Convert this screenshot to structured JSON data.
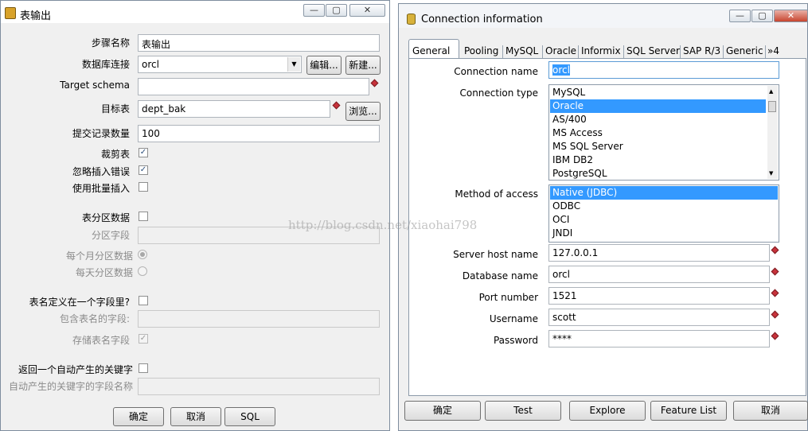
{
  "left_window": {
    "title": "表输出",
    "fields": {
      "step_name_label": "步骤名称",
      "step_name_value": "表输出",
      "db_conn_label": "数据库连接",
      "db_conn_value": "orcl",
      "edit_button": "编辑...",
      "new_button": "新建...",
      "target_schema_label": "Target schema",
      "target_schema_value": "",
      "target_table_label": "目标表",
      "target_table_value": "dept_bak",
      "browse_button": "浏览...",
      "commit_size_label": "提交记录数量",
      "commit_size_value": "100",
      "truncate_label": "裁剪表",
      "ignore_errors_label": "忽略插入错误",
      "batch_insert_label": "使用批量插入",
      "partition_label": "表分区数据",
      "partition_field_label": "分区字段",
      "partition_monthly_label": "每个月分区数据",
      "partition_daily_label": "每天分区数据",
      "table_name_in_field_label": "表名定义在一个字段里?",
      "field_with_table_name_label": "包含表名的字段:",
      "store_table_name_label": "存储表名字段",
      "return_key_label": "返回一个自动产生的关键字",
      "return_key_field_label": "自动产生的关键字的字段名称"
    },
    "checks": {
      "truncate": true,
      "ignore_errors": true,
      "batch_insert": false,
      "partition": false,
      "table_name_in_field": false,
      "store_table_name": true,
      "return_key": false
    },
    "buttons": {
      "ok": "确定",
      "cancel": "取消",
      "sql": "SQL"
    }
  },
  "right_window": {
    "title": "Connection information",
    "tabs": [
      "General",
      "Pooling",
      "MySQL",
      "Oracle",
      "Informix",
      "SQL Server",
      "SAP R/3",
      "Generic",
      "»4"
    ],
    "connection_name_label": "Connection name",
    "connection_name_value": "orcl",
    "connection_type_label": "Connection type",
    "connection_types": [
      "MySQL",
      "Oracle",
      "AS/400",
      "MS Access",
      "MS SQL Server",
      "IBM DB2",
      "PostgreSQL"
    ],
    "selected_connection_type": "Oracle",
    "method_of_access_label": "Method of access",
    "access_methods": [
      "Native (JDBC)",
      "ODBC",
      "OCI",
      "JNDI"
    ],
    "selected_access_method": "Native (JDBC)",
    "server_host_label": "Server host name",
    "server_host_value": "127.0.0.1",
    "database_name_label": "Database name",
    "database_name_value": "orcl",
    "port_label": "Port number",
    "port_value": "1521",
    "username_label": "Username",
    "username_value": "scott",
    "password_label": "Password",
    "password_value": "****",
    "buttons": {
      "ok": "确定",
      "test": "Test",
      "explore": "Explore",
      "feature_list": "Feature List",
      "cancel": "取消"
    }
  },
  "watermark": "http://blog.csdn.net/xiaohai798",
  "colors": {
    "selection": "#3399ff",
    "required_marker": "#c8323b"
  }
}
